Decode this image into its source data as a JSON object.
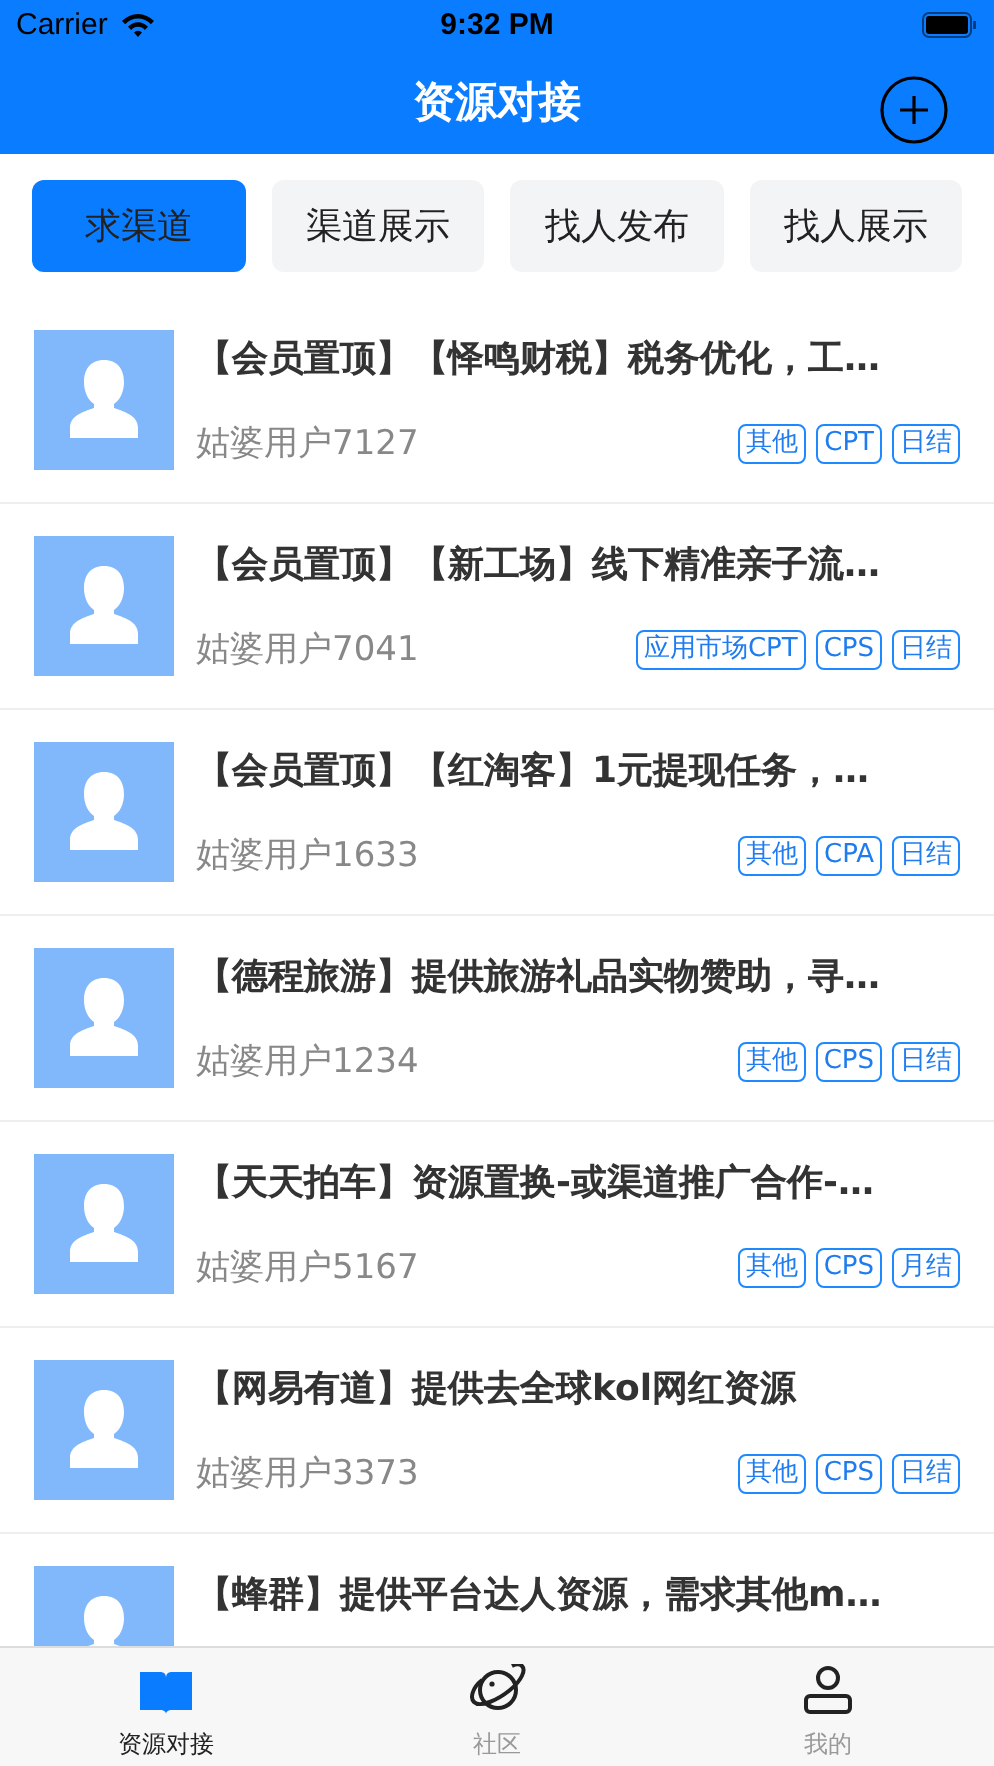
{
  "status_bar": {
    "carrier": "Carrier",
    "time": "9:32 PM"
  },
  "nav": {
    "title": "资源对接"
  },
  "tabs": [
    {
      "label": "求渠道",
      "selected": true
    },
    {
      "label": "渠道展示",
      "selected": false
    },
    {
      "label": "找人发布",
      "selected": false
    },
    {
      "label": "找人展示",
      "selected": false
    }
  ],
  "items": [
    {
      "title": "【会员置顶】【怿鸣财税】税务优化，工…",
      "user": "姑婆用户7127",
      "tags": [
        "其他",
        "CPT",
        "日结"
      ]
    },
    {
      "title": "【会员置顶】【新工场】线下精准亲子流…",
      "user": "姑婆用户7041",
      "tags": [
        "应用市场CPT",
        "CPS",
        "日结"
      ]
    },
    {
      "title": "【会员置顶】【红淘客】1元提现任务，…",
      "user": "姑婆用户1633",
      "tags": [
        "其他",
        "CPA",
        "日结"
      ]
    },
    {
      "title": "【德程旅游】提供旅游礼品实物赞助，寻…",
      "user": "姑婆用户1234",
      "tags": [
        "其他",
        "CPS",
        "日结"
      ]
    },
    {
      "title": "【天天拍车】资源置换-或渠道推广合作-…",
      "user": "姑婆用户5167",
      "tags": [
        "其他",
        "CPS",
        "月结"
      ]
    },
    {
      "title": "【网易有道】提供去全球kol网红资源",
      "user": "姑婆用户3373",
      "tags": [
        "其他",
        "CPS",
        "日结"
      ]
    },
    {
      "title": "【蜂群】提供平台达人资源，需求其他m…"
    }
  ],
  "tab_bar": [
    {
      "kind": "book",
      "label": "资源对接",
      "selected": true
    },
    {
      "kind": "planet",
      "label": "社区",
      "selected": false
    },
    {
      "kind": "person",
      "label": "我的",
      "selected": false
    }
  ]
}
